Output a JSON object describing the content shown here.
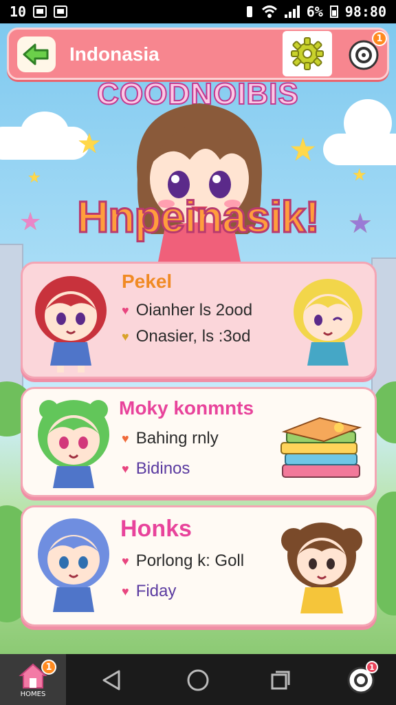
{
  "status_bar": {
    "left_time": "10",
    "battery": "6%",
    "clock": "98:80"
  },
  "header": {
    "title": "Indonasia",
    "back_icon": "arrow-left-icon",
    "settings_icon": "gear-icon",
    "notification_icon": "bell-icon",
    "notification_count": "1"
  },
  "hero": {
    "logo_top": "COODNOIBIS",
    "logo_main": "Hnpeinasik!"
  },
  "cards": [
    {
      "title": "Pekel",
      "lines": [
        "Oianher ls 2ood",
        "Onasier, ls :3od"
      ]
    },
    {
      "title": "Moky konmnts",
      "lines": [
        "Bahing rnly",
        "Bidinos"
      ]
    },
    {
      "title": "Honks",
      "lines": [
        "Porlong k: Goll",
        "Fiday"
      ]
    }
  ],
  "navbar": {
    "home_label": "HOMES",
    "home_count": "1",
    "profile_count": "1"
  },
  "colors": {
    "header": "#f7868f",
    "card1_bg": "#fbd6da",
    "card_bg": "#fffaf4",
    "title_pink": "#e8439b",
    "title_orange": "#f08a24"
  }
}
